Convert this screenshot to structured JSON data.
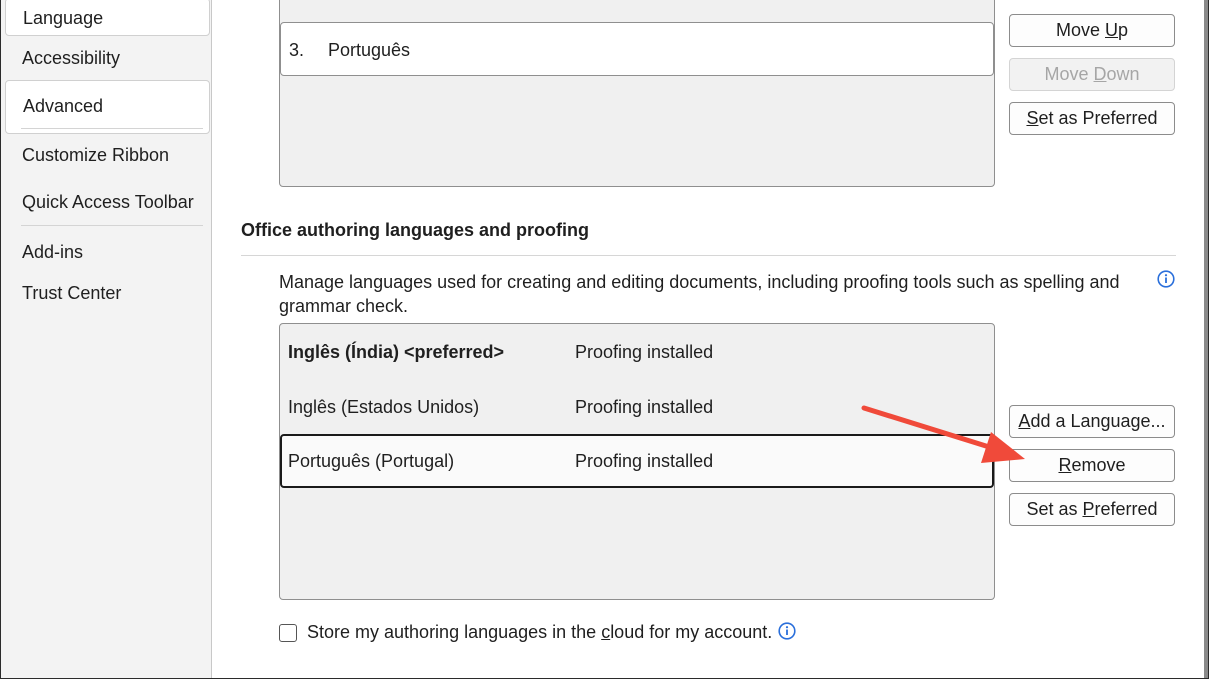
{
  "sidebar": {
    "items": [
      {
        "label": "Language"
      },
      {
        "label": "Accessibility"
      },
      {
        "label": "Advanced"
      },
      {
        "label": "Customize Ribbon"
      },
      {
        "label": "Quick Access Toolbar"
      },
      {
        "label": "Add-ins"
      },
      {
        "label": "Trust Center"
      }
    ]
  },
  "display_languages": {
    "rows": [
      {
        "num": "3.",
        "name": "Português"
      }
    ],
    "buttons": {
      "move_up_pre": "Move ",
      "move_up_key": "U",
      "move_up_post": "p",
      "move_down_pre": "Move ",
      "move_down_key": "D",
      "move_down_post": "own",
      "set_pref_pre": "",
      "set_pref_key": "S",
      "set_pref_post": "et as Preferred"
    }
  },
  "authoring": {
    "title": "Office authoring languages and proofing",
    "description": "Manage languages used for creating and editing documents, including proofing tools such as spelling and grammar check.",
    "rows": [
      {
        "name": "Inglês (Índia) <preferred>",
        "status": "Proofing installed"
      },
      {
        "name": "Inglês (Estados Unidos)",
        "status": "Proofing installed"
      },
      {
        "name": "Português (Portugal)",
        "status": "Proofing installed"
      }
    ],
    "buttons": {
      "add_pre": "",
      "add_key": "A",
      "add_post": "dd a Language...",
      "remove_pre": "",
      "remove_key": "R",
      "remove_post": "emove",
      "set_pref_pre": "Set as ",
      "set_pref_key": "P",
      "set_pref_post": "referred"
    },
    "cloud_checkbox": {
      "pre": "Store my authoring languages in the ",
      "key": "c",
      "post": "loud for my account.",
      "checked": false
    }
  },
  "colors": {
    "info_icon": "#2a6fdb",
    "arrow": "#f04a3a"
  }
}
